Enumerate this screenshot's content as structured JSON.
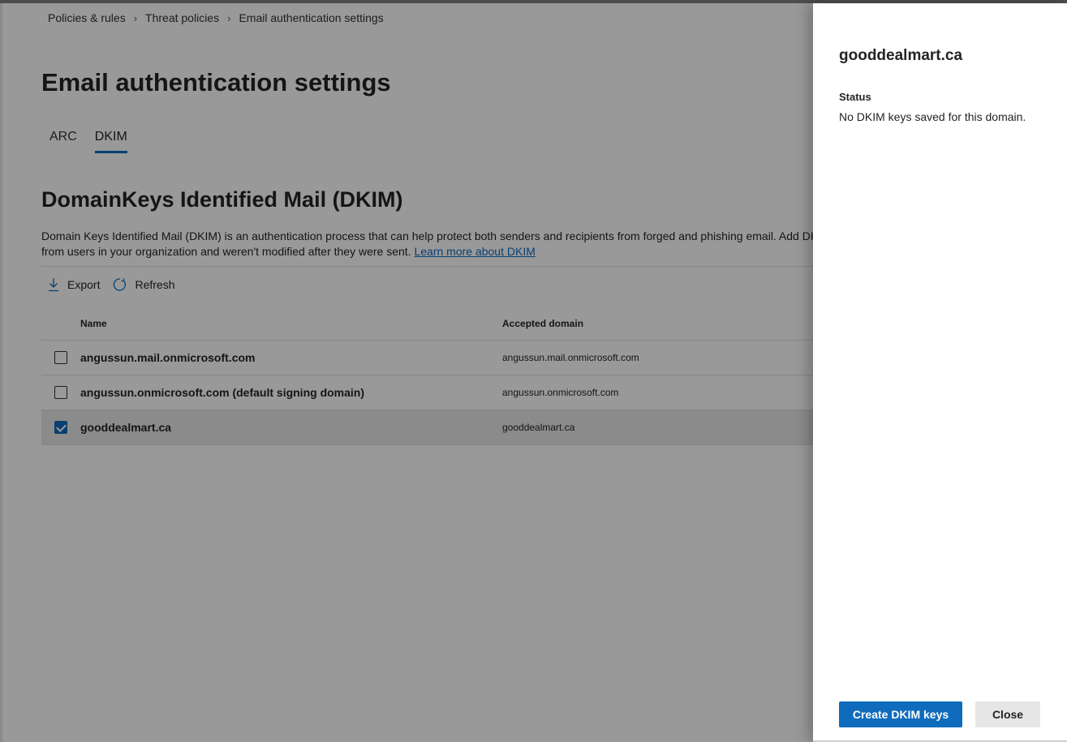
{
  "breadcrumb": [
    "Policies & rules",
    "Threat policies",
    "Email authentication settings"
  ],
  "page_title": "Email authentication settings",
  "tabs": [
    {
      "label": "ARC",
      "active": false
    },
    {
      "label": "DKIM",
      "active": true
    }
  ],
  "section": {
    "title": "DomainKeys Identified Mail (DKIM)",
    "description_line1": "Domain Keys Identified Mail (DKIM) is an authentication process that can help protect both senders and recipients from forged and phishing email. Add DKIM",
    "description_line2": "from users in your organization and weren't modified after they were sent.",
    "learn_more": "Learn more about DKIM"
  },
  "toolbar": {
    "export_label": "Export",
    "refresh_label": "Refresh",
    "export_icon": "download-icon",
    "refresh_icon": "refresh-icon"
  },
  "table": {
    "headers": {
      "name": "Name",
      "accepted_domain": "Accepted domain"
    },
    "rows": [
      {
        "name": "angussun.mail.onmicrosoft.com",
        "accepted_domain": "angussun.mail.onmicrosoft.com",
        "checked": false
      },
      {
        "name": "angussun.onmicrosoft.com (default signing domain)",
        "accepted_domain": "angussun.onmicrosoft.com",
        "checked": false
      },
      {
        "name": "gooddealmart.ca",
        "accepted_domain": "gooddealmart.ca",
        "checked": true
      }
    ]
  },
  "panel": {
    "title": "gooddealmart.ca",
    "status_label": "Status",
    "status_value": "No DKIM keys saved for this domain.",
    "create_button": "Create DKIM keys",
    "close_button": "Close"
  },
  "colors": {
    "accent": "#0f6cbd",
    "overlay": "rgba(0,0,0,0.4)"
  }
}
